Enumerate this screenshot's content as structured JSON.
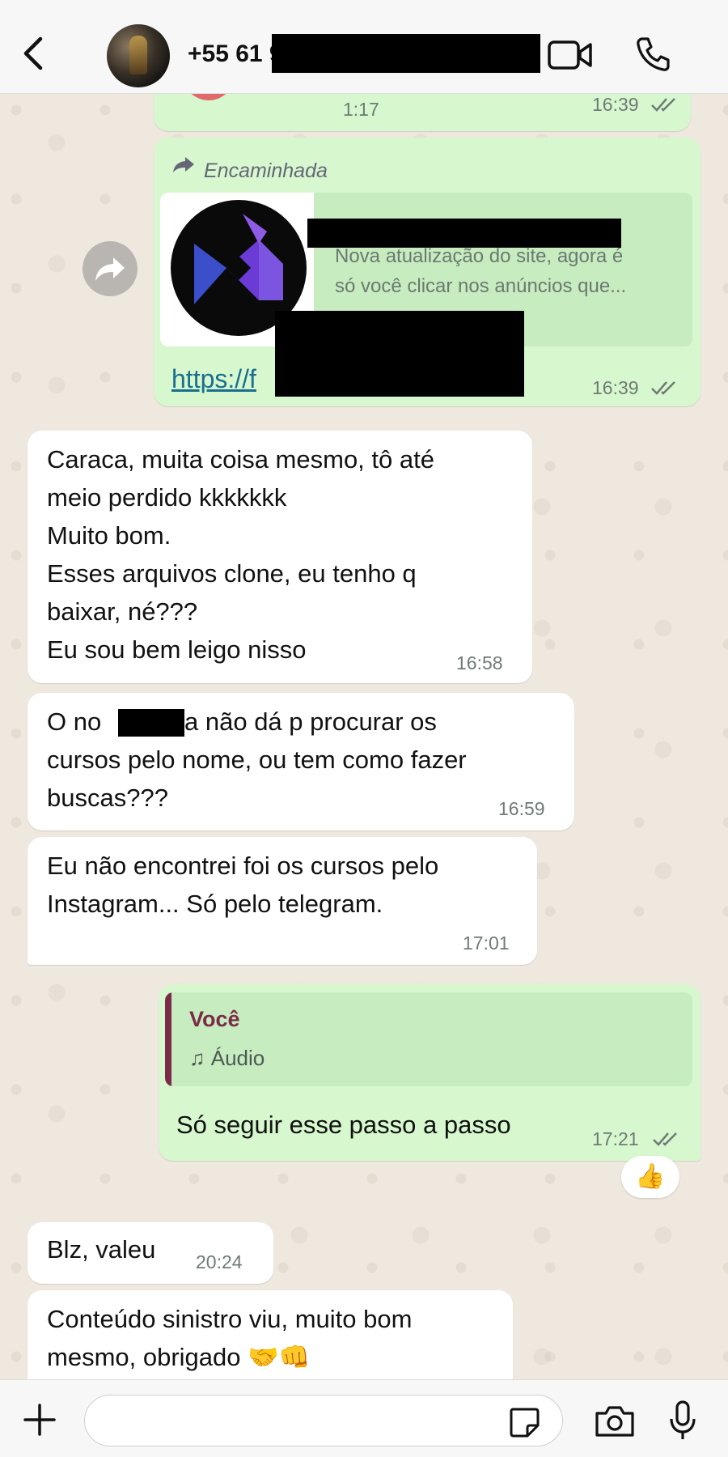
{
  "header": {
    "contact_name": "+55 61 9",
    "back_icon": "chevron-left-icon",
    "video_icon": "video-camera-icon",
    "phone_icon": "phone-icon"
  },
  "messages": {
    "audio_prev": {
      "duration": "1:17",
      "time": "16:39"
    },
    "forwarded": {
      "forward_label": "Encaminhada",
      "preview_description": "Nova atualização do site, agora é\nsó você clicar nos anúncios que...",
      "link": "https://f",
      "time": "16:39"
    },
    "in1": {
      "text": "Caraca, muita coisa mesmo, tô até\nmeio perdido kkkkkkk\nMuito bom.\nEsses arquivos clone, eu tenho q\nbaixar, né???\nEu sou bem leigo nisso",
      "time": "16:58"
    },
    "in2": {
      "text_a": "O no",
      "text_b": "a não dá p procurar os",
      "text_rest": "cursos pelo nome, ou tem como fazer\nbuscas???",
      "time": "16:59"
    },
    "in3": {
      "text": "Eu não encontrei foi os cursos pelo\nInstagram... Só pelo telegram.",
      "time": "17:01"
    },
    "out_reply": {
      "quote_author": "Você",
      "quote_content": "♫ Áudio",
      "text": "Só seguir esse passo a passo",
      "time": "17:21",
      "reaction": "👍"
    },
    "in4": {
      "text": "Blz, valeu",
      "time": "20:24"
    },
    "in5": {
      "text": "Conteúdo sinistro viu, muito bom\nmesmo, obrigado 🤝👊"
    }
  },
  "input_bar": {
    "placeholder": "",
    "icons": [
      "plus-icon",
      "sticker-icon",
      "camera-icon",
      "microphone-icon"
    ]
  },
  "colors": {
    "outgoing_bubble": "#d7f8cf",
    "incoming_bubble": "#ffffff",
    "quote_accent": "#7b2b48",
    "read_ticks": "#6e7b75"
  }
}
